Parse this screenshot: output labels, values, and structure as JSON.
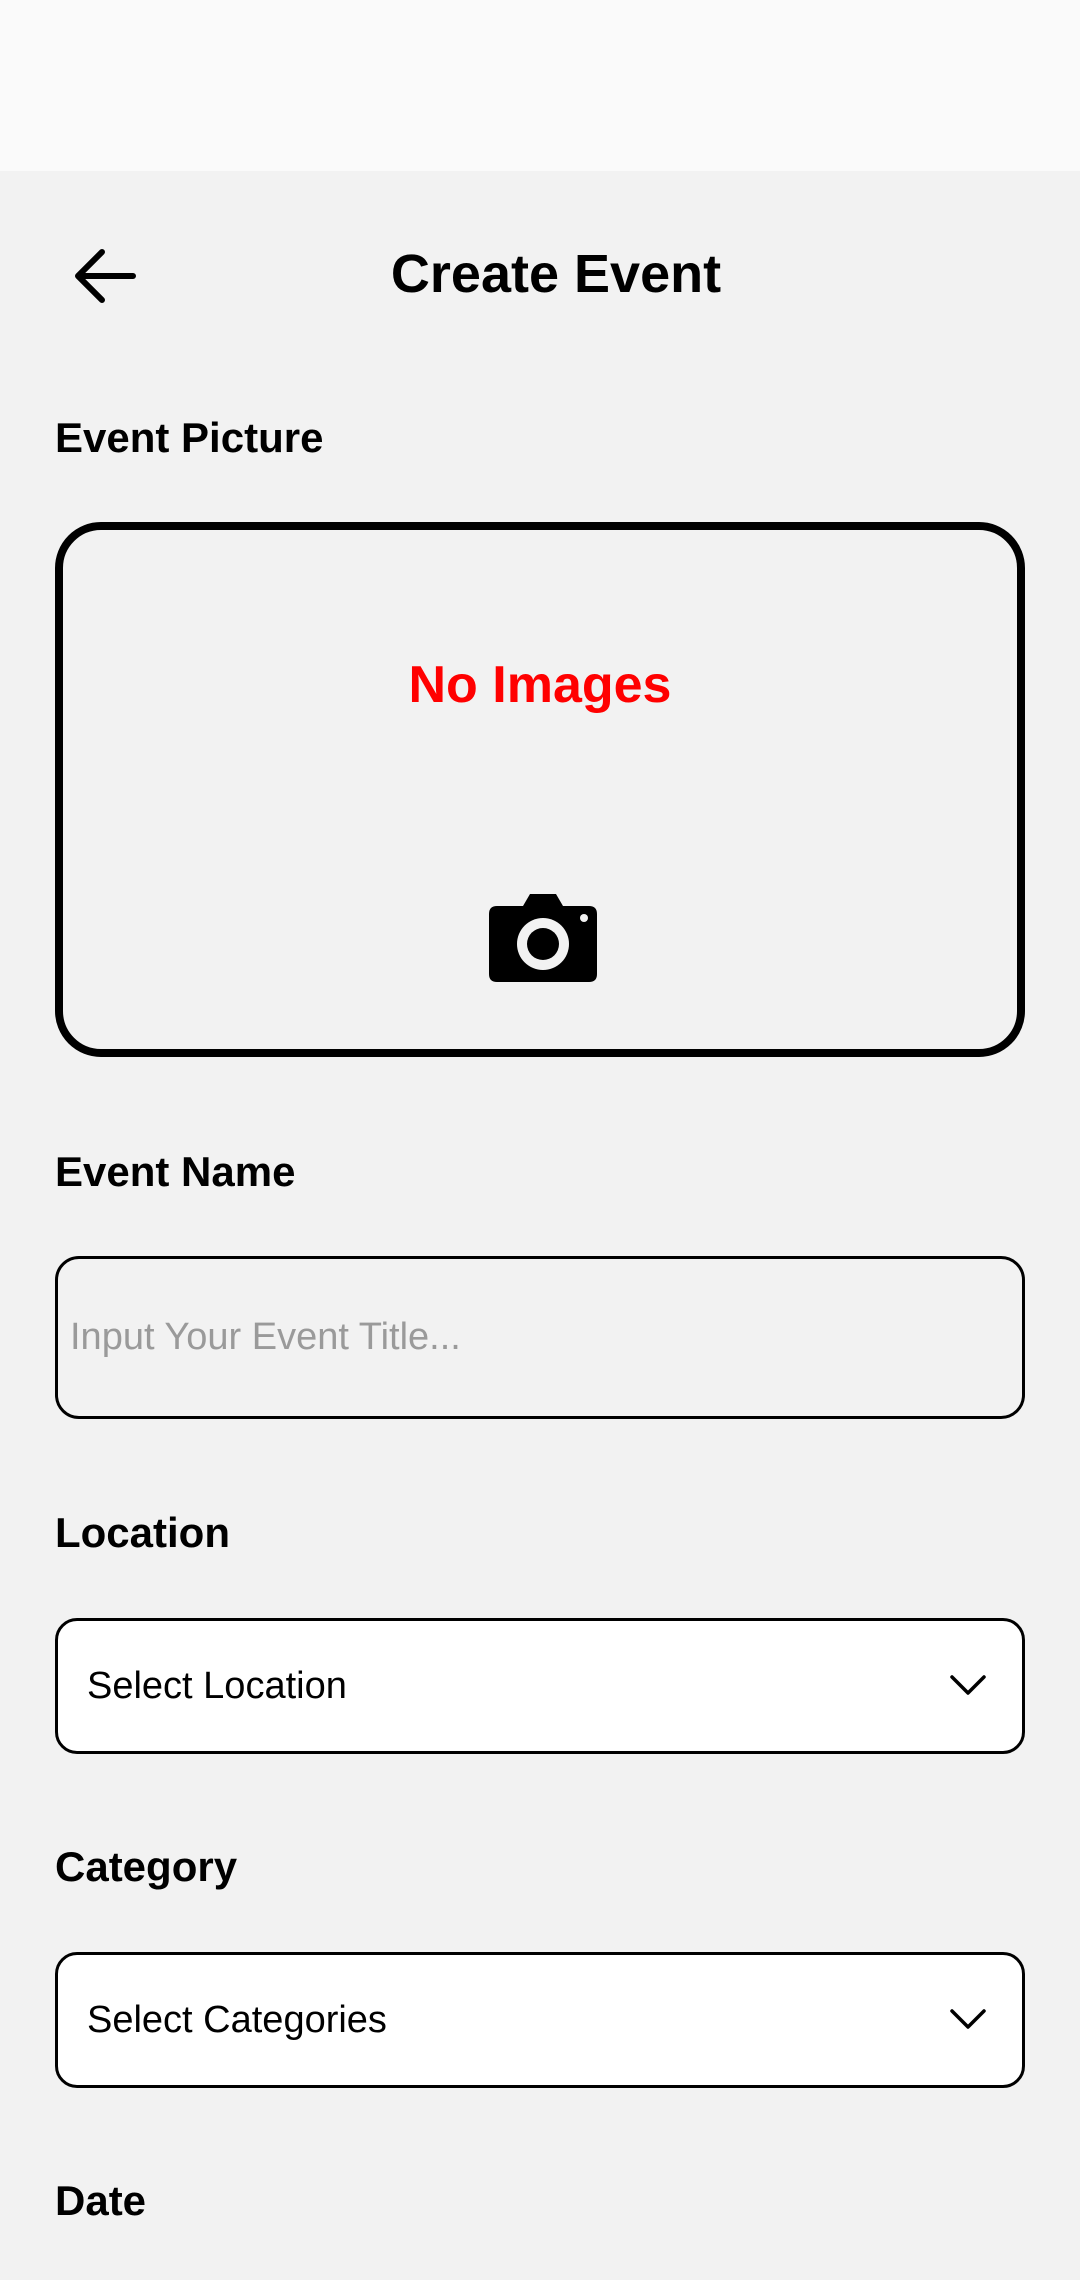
{
  "header": {
    "title": "Create Event",
    "back_icon": "arrow-left-icon"
  },
  "picture": {
    "label": "Event Picture",
    "empty_text": "No Images",
    "empty_text_color": "#ff0000",
    "camera_icon": "camera-icon"
  },
  "event_name": {
    "label": "Event Name",
    "value": "",
    "placeholder": "Input Your Event Title..."
  },
  "location": {
    "label": "Location",
    "selected": "Select Location",
    "icon": "chevron-down-icon"
  },
  "category": {
    "label": "Category",
    "selected": "Select Categories",
    "icon": "chevron-down-icon"
  },
  "date": {
    "label": "Date"
  }
}
